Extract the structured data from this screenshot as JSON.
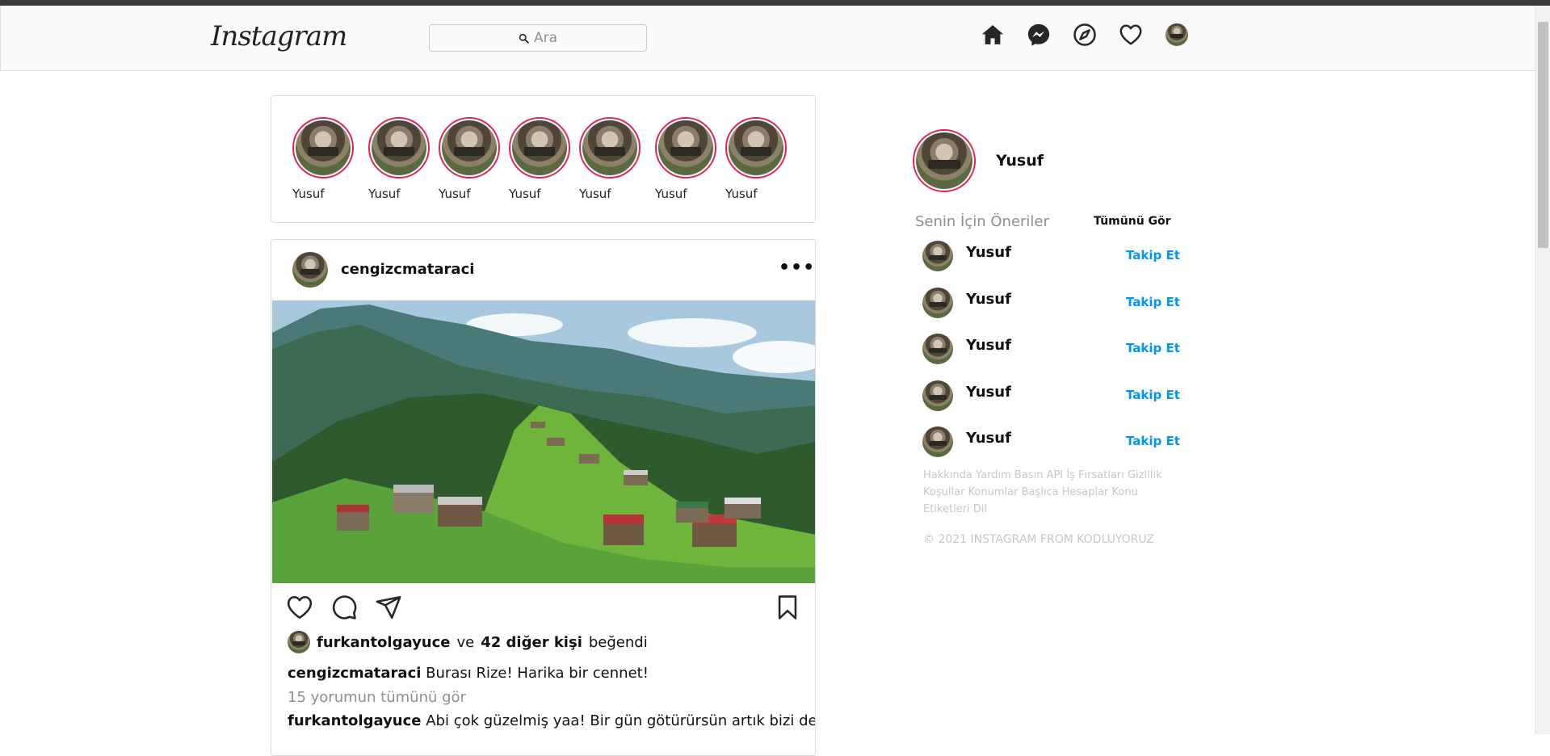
{
  "navbar": {
    "logo": "Instagram",
    "search_placeholder": "Ara",
    "icons": [
      "home-icon",
      "messenger-icon",
      "explore-icon",
      "heart-icon",
      "profile-avatar"
    ]
  },
  "stories": [
    {
      "name": "Yusuf"
    },
    {
      "name": "Yusuf"
    },
    {
      "name": "Yusuf"
    },
    {
      "name": "Yusuf"
    },
    {
      "name": "Yusuf"
    },
    {
      "name": "Yusuf"
    },
    {
      "name": "Yusuf"
    }
  ],
  "post": {
    "username": "cengizcmataraci",
    "more_label": "•••",
    "liked_by_user": "furkantolgayuce",
    "liked_and": "ve",
    "liked_others": "42 diğer kişi",
    "liked_suffix": "beğendi",
    "caption_user": "cengizcmataraci",
    "caption_text": "Burası Rize! Harika bir cennet!",
    "view_all_comments": "15 yorumun tümünü gör",
    "comment_user": "furkantolgayuce",
    "comment_text": "Abi çok güzelmiş yaa! Bir gün götürürsün artık bizi de🙂"
  },
  "sidebar": {
    "me_name": "Yusuf",
    "suggestions_title": "Senin İçin Öneriler",
    "see_all": "Tümünü Gör",
    "follow_label": "Takip Et",
    "suggestions": [
      {
        "name": "Yusuf"
      },
      {
        "name": "Yusuf"
      },
      {
        "name": "Yusuf"
      },
      {
        "name": "Yusuf"
      },
      {
        "name": "Yusuf"
      }
    ],
    "footer_links": [
      "Hakkında",
      "Yardım",
      "Basın",
      "API",
      "İş Fırsatları",
      "Gizlilik",
      "Koşullar",
      "Konumlar",
      "Başlıca Hesaplar",
      "Konu Etiketleri",
      "Dil"
    ],
    "copyright": "© 2021 INSTAGRAM FROM KODLUYORUZ"
  },
  "colors": {
    "accent_blue": "#0095f6",
    "story_ring": "#e0245e",
    "muted_text": "#8e8e8e"
  }
}
